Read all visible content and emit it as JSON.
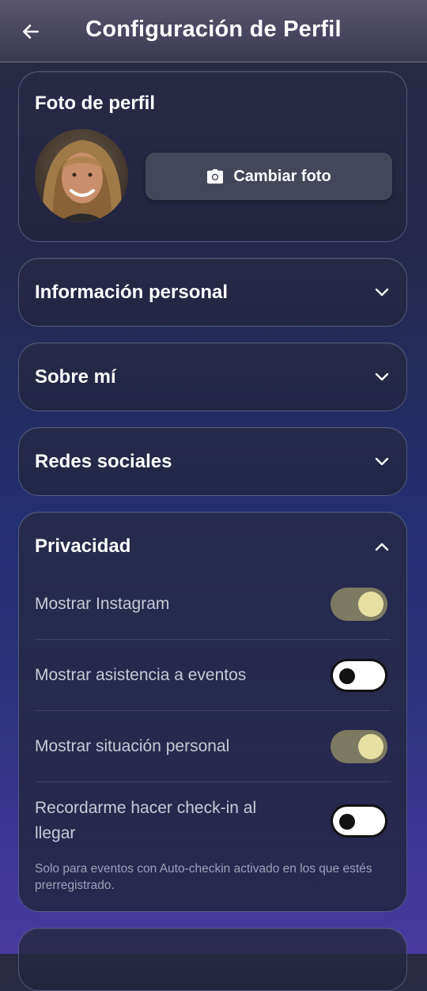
{
  "header": {
    "title": "Configuración de Perfil",
    "back_icon": "arrow-left-icon"
  },
  "photo": {
    "title": "Foto de perfil",
    "change_label": "Cambiar foto",
    "camera_icon": "camera-icon"
  },
  "sections": {
    "personal": "Información personal",
    "about": "Sobre mí",
    "social": "Redes sociales"
  },
  "privacy": {
    "title": "Privacidad",
    "items": [
      {
        "label": "Mostrar Instagram",
        "on": true
      },
      {
        "label": "Mostrar asistencia a eventos",
        "on": false
      },
      {
        "label": "Mostrar situación personal",
        "on": true
      },
      {
        "label": "Recordarme hacer check-in al llegar",
        "on": false
      }
    ],
    "note": "Solo para eventos con Auto-checkin activado en los que estés prerregistrado."
  },
  "colors": {
    "toggle_on_track": "#7d7a62",
    "toggle_on_knob": "#e6e0a2",
    "toggle_off_track": "#ffffff"
  }
}
